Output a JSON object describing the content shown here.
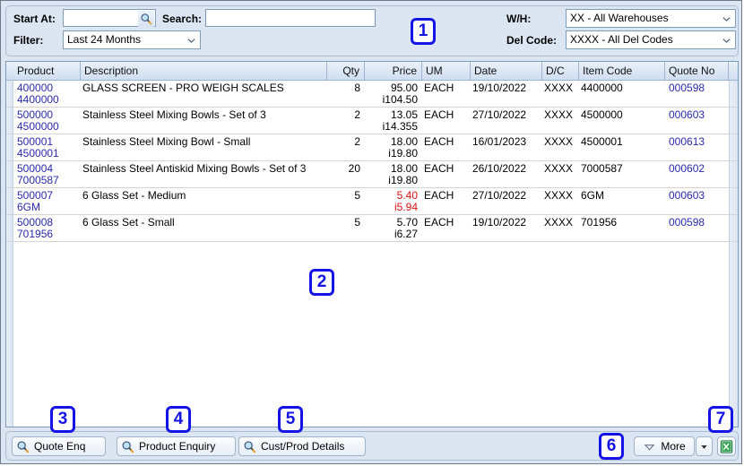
{
  "filters": {
    "start_at": {
      "label": "Start At:",
      "value": "",
      "placeholder": "",
      "icon": "search-icon"
    },
    "search": {
      "label": "Search:",
      "value": "",
      "placeholder": ""
    },
    "filter": {
      "label": "Filter:",
      "value": "Last 24 Months"
    },
    "warehouse": {
      "label": "W/H:",
      "value": "XX - All Warehouses"
    },
    "del_code": {
      "label": "Del Code:",
      "value": "XXXX - All Del Codes"
    }
  },
  "grid": {
    "columns": [
      {
        "key": "product",
        "label": "Product"
      },
      {
        "key": "description",
        "label": "Description"
      },
      {
        "key": "qty",
        "label": "Qty"
      },
      {
        "key": "price",
        "label": "Price"
      },
      {
        "key": "um",
        "label": "UM"
      },
      {
        "key": "date",
        "label": "Date"
      },
      {
        "key": "dc",
        "label": "D/C"
      },
      {
        "key": "item_code",
        "label": "Item Code"
      },
      {
        "key": "quote_no",
        "label": "Quote No"
      }
    ],
    "rows": [
      {
        "product": "400000",
        "product_alt": "4400000",
        "description": "GLASS SCREEN - PRO WEIGH SCALES",
        "qty": "8",
        "price": "95.00",
        "price_alt": "i104.50",
        "price_red": false,
        "um": "EACH",
        "date": "19/10/2022",
        "dc": "XXXX",
        "item_code": "4400000",
        "quote_no": "000598"
      },
      {
        "product": "500000",
        "product_alt": "4500000",
        "description": "Stainless Steel Mixing Bowls - Set of 3",
        "qty": "2",
        "price": "13.05",
        "price_alt": "i14.355",
        "price_red": false,
        "um": "EACH",
        "date": "27/10/2022",
        "dc": "XXXX",
        "item_code": "4500000",
        "quote_no": "000603"
      },
      {
        "product": "500001",
        "product_alt": "4500001",
        "description": "Stainless Steel Mixing Bowl - Small",
        "qty": "2",
        "price": "18.00",
        "price_alt": "i19.80",
        "price_red": false,
        "um": "EACH",
        "date": "16/01/2023",
        "dc": "XXXX",
        "item_code": "4500001",
        "quote_no": "000613"
      },
      {
        "product": "500004",
        "product_alt": "7000587",
        "description": "Stainless Steel Antiskid Mixing Bowls - Set of 3",
        "qty": "20",
        "price": "18.00",
        "price_alt": "i19.80",
        "price_red": false,
        "um": "EACH",
        "date": "26/10/2022",
        "dc": "XXXX",
        "item_code": "7000587",
        "quote_no": "000602"
      },
      {
        "product": "500007",
        "product_alt": "6GM",
        "description": "6 Glass Set - Medium",
        "qty": "5",
        "price": "5.40",
        "price_alt": "i5.94",
        "price_red": true,
        "um": "EACH",
        "date": "27/10/2022",
        "dc": "XXXX",
        "item_code": "6GM",
        "quote_no": "000603"
      },
      {
        "product": "500008",
        "product_alt": "701956",
        "description": "6 Glass Set - Small",
        "qty": "5",
        "price": "5.70",
        "price_alt": "i6.27",
        "price_red": false,
        "um": "EACH",
        "date": "19/10/2022",
        "dc": "XXXX",
        "item_code": "701956",
        "quote_no": "000598"
      }
    ]
  },
  "toolbar": {
    "quote_enq": {
      "label": "Quote Enq",
      "icon": "search-icon"
    },
    "product_enquiry": {
      "label": "Product Enquiry",
      "icon": "search-icon"
    },
    "cust_prod_details": {
      "label": "Cust/Prod Details",
      "icon": "search-icon"
    },
    "more": {
      "label": "More",
      "icon": "triangle-down-icon"
    },
    "more_dropdown": {
      "icon": "caret-down-icon"
    },
    "excel_export": {
      "icon": "excel-icon"
    }
  },
  "annotations": [
    {
      "number": "1"
    },
    {
      "number": "2"
    },
    {
      "number": "3"
    },
    {
      "number": "4"
    },
    {
      "number": "5"
    },
    {
      "number": "6"
    },
    {
      "number": "7"
    }
  ],
  "colors": {
    "accent": "#1414e6",
    "link": "#2a2ab0",
    "alert": "#e01010",
    "panel": "#dce6f2"
  }
}
